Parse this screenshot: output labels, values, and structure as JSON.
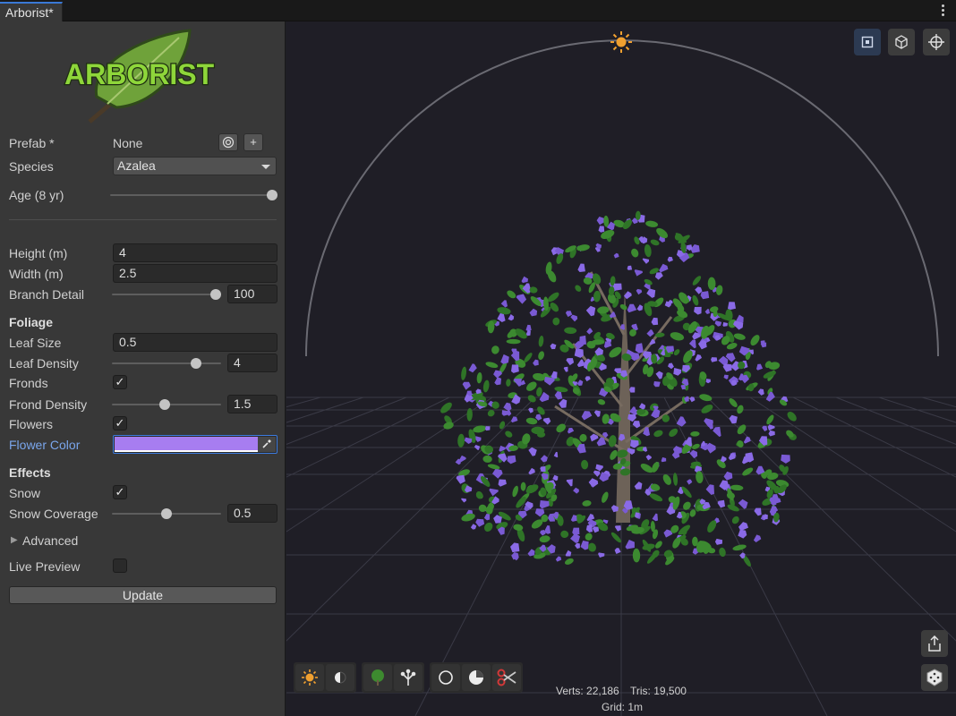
{
  "tab": {
    "title": "Arborist*"
  },
  "logo": {
    "text": "ARBORIST"
  },
  "prefab": {
    "label": "Prefab *",
    "value": "None",
    "target_icon": "target-icon",
    "add_label": "+"
  },
  "species": {
    "label": "Species",
    "value": "Azalea"
  },
  "age": {
    "label": "Age (8 yr)",
    "value": 1.0
  },
  "height": {
    "label": "Height (m)",
    "value": "4"
  },
  "width": {
    "label": "Width (m)",
    "value": "2.5"
  },
  "branch_detail": {
    "label": "Branch Detail",
    "value": "100",
    "slider": 0.95
  },
  "foliage": {
    "title": "Foliage",
    "leaf_size": {
      "label": "Leaf Size",
      "value": "0.5"
    },
    "leaf_density": {
      "label": "Leaf Density",
      "value": "4",
      "slider": 0.77
    },
    "fronds": {
      "label": "Fronds",
      "checked": true
    },
    "frond_density": {
      "label": "Frond Density",
      "value": "1.5",
      "slider": 0.48
    },
    "flowers": {
      "label": "Flowers",
      "checked": true
    },
    "flower_color": {
      "label": "Flower Color",
      "color": "#a77df0"
    }
  },
  "effects": {
    "title": "Effects",
    "snow": {
      "label": "Snow",
      "checked": true
    },
    "snow_coverage": {
      "label": "Snow Coverage",
      "value": "0.5",
      "slider": 0.5
    }
  },
  "advanced": {
    "label": "Advanced"
  },
  "live_preview": {
    "label": "Live Preview",
    "checked": false
  },
  "update": {
    "label": "Update"
  },
  "checkmark": "✓",
  "stats": {
    "verts": "Verts: 22,186",
    "tris": "Tris: 19,500",
    "grid": "Grid: 1m"
  },
  "colors": {
    "accent": "#3a79d6",
    "sun": "#f0a030",
    "leaf": "#3c8a30",
    "flower": "#8a6ae6"
  }
}
